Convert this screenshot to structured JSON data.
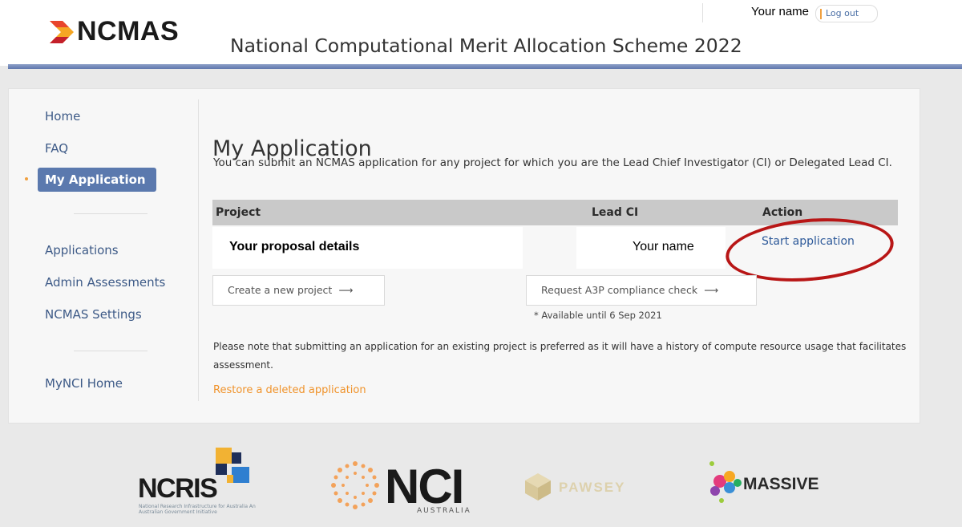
{
  "header": {
    "logo_text": "NCMAS",
    "scheme_title": "National Computational Merit Allocation Scheme 2022",
    "user_name": "Your name",
    "logout_label": "Log out"
  },
  "sidebar": {
    "items": [
      {
        "label": "Home"
      },
      {
        "label": "FAQ"
      },
      {
        "label": "My Application",
        "active": true
      },
      {
        "label": "Applications"
      },
      {
        "label": "Admin Assessments"
      },
      {
        "label": "NCMAS Settings"
      },
      {
        "label": "MyNCI Home"
      }
    ]
  },
  "main": {
    "title": "My Application",
    "intro": "You can submit an NCMAS application for any project for which you are the Lead Chief Investigator (CI) or Delegated Lead CI.",
    "table": {
      "headers": [
        "Project",
        "Lead CI",
        "Action"
      ],
      "rows": [
        {
          "project": "Your proposal details",
          "lead_ci": "Your name",
          "action": "Start application"
        }
      ]
    },
    "create_button": "Create a new project",
    "compliance_button": "Request A3P compliance check",
    "arrow": "⟶",
    "availability_note": "* Available until 6 Sep 2021",
    "note": "Please note that submitting an application for an existing project is preferred as it will have a history of compute resource usage that facilitates assessment.",
    "restore_link": "Restore a deleted application"
  },
  "partners": {
    "ncris": {
      "name": "NCRIS",
      "sub": "National Research Infrastructure for Australia An Australian Government Initiative"
    },
    "nci": {
      "name": "NCI",
      "sub": "AUSTRALIA"
    },
    "pawsey": {
      "name": "PAWSEY"
    },
    "massive": {
      "name": "MASSIVE"
    }
  },
  "colors": {
    "accent": "#5b79ae",
    "link": "#2e5a9a",
    "restore": "#f0932b",
    "highlight": "#b81616",
    "header_rule": "#5f77ae"
  }
}
